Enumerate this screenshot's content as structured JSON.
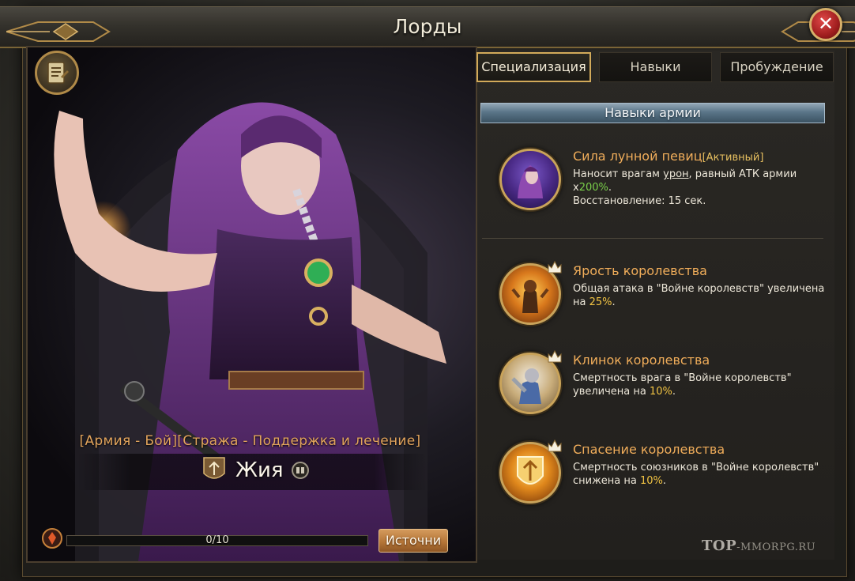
{
  "window": {
    "title": "Лорды"
  },
  "lord": {
    "roles": "[Армия - Бой][Стража - Поддержка и лечение]",
    "name": "Жия",
    "progress": {
      "current": 0,
      "max": 10,
      "text": "0/10"
    },
    "source_button": "Источни"
  },
  "tabs": [
    {
      "label": "Специализация",
      "active": true
    },
    {
      "label": "Навыки",
      "active": false
    },
    {
      "label": "Пробуждение",
      "active": false
    }
  ],
  "section_header": "Навыки армии",
  "skills": [
    {
      "name": "Сила лунной певиц",
      "tag": "[Активный]",
      "desc_1": "Наносит врагам ",
      "desc_link": "урон",
      "desc_2": ", равный АТК армии х",
      "desc_value": "200%",
      "desc_3": ".",
      "cooldown": "Восстановление: 15 сек.",
      "icon": "moon-singer-portrait-icon"
    },
    {
      "name": "Ярость королевства",
      "desc_1": "Общая атака в \"Войне королевств\" увеличена на ",
      "desc_value": "25%",
      "desc_2": ".",
      "icon": "armored-warrior-icon"
    },
    {
      "name": "Клинок королевства",
      "desc_1": "Смертность врага в \"Войне королевств\" увеличена на ",
      "desc_value": "10%",
      "desc_2": ".",
      "icon": "knight-blade-icon"
    },
    {
      "name": "Спасение королевства",
      "desc_1": "Смертность союзников в \"Войне королевств\" снижена на ",
      "desc_value": "10%",
      "desc_2": ".",
      "icon": "golden-shield-icon"
    }
  ],
  "watermark": {
    "brand": "TOP",
    "site": "-MMORPG.RU"
  },
  "colors": {
    "accent_gold": "#d2aa5a",
    "skill_name": "#f0ad5a",
    "value_highlight": "#f2c443",
    "value_green": "#7ad04a",
    "close_red": "#c02828"
  }
}
